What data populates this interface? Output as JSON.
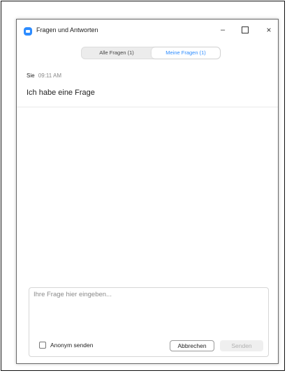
{
  "window": {
    "title": "Fragen und Antworten",
    "minimize_glyph": "–",
    "close_glyph": "×"
  },
  "tabs": [
    {
      "label": "Alle Fragen (1)",
      "active": false
    },
    {
      "label": "Meine Fragen (1)",
      "active": true
    }
  ],
  "messages": [
    {
      "sender": "Sie",
      "time": "09:11 AM",
      "text": "Ich habe eine Frage"
    }
  ],
  "compose": {
    "placeholder": "Ihre Frage hier eingeben...",
    "anonymous_label": "Anonym senden",
    "cancel_label": "Abbrechen",
    "send_label": "Senden"
  },
  "colors": {
    "accent": "#2d8cff",
    "disabled_text": "#b0b0b0"
  },
  "icons": {
    "app": "zoom-app-icon",
    "minimize": "minimize-icon",
    "maximize": "maximize-icon",
    "close": "close-icon"
  }
}
